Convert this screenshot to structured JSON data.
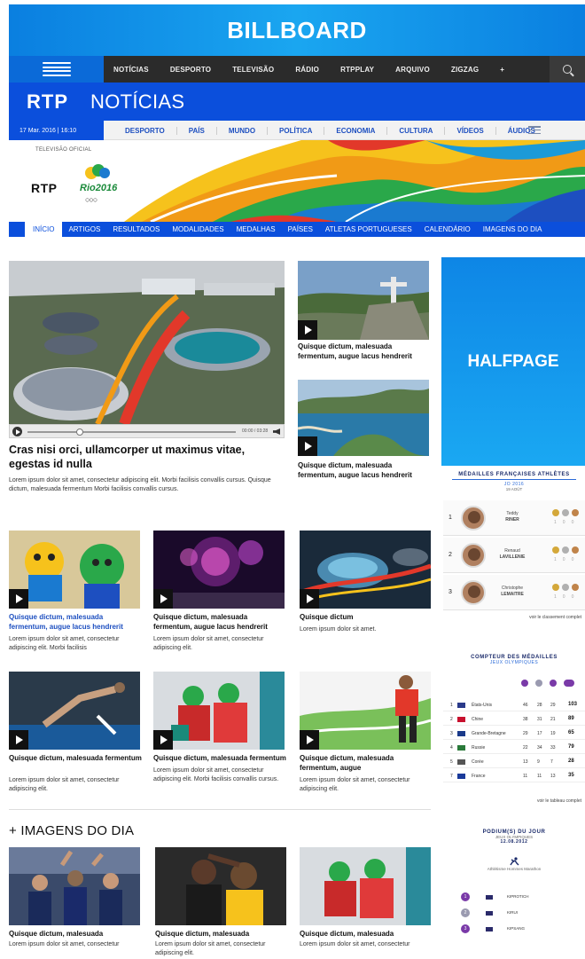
{
  "ads": {
    "billboard": "BILLBOARD",
    "halfpage": "HALFPAGE"
  },
  "topnav": {
    "items": [
      "NOTÍCIAS",
      "DESPORTO",
      "TELEVISÃO",
      "RÁDIO",
      "RTPPLAY",
      "ARQUIVO",
      "ZIGZAG",
      "+"
    ]
  },
  "brand": {
    "rtp": "RTP",
    "noticias": "NOTÍCIAS"
  },
  "subnav": {
    "date": "17 Mar. 2016 | 16:10",
    "items": [
      "DESPORTO",
      "PAÍS",
      "MUNDO",
      "POLÍTICA",
      "ECONOMIA",
      "CULTURA",
      "VÍDEOS",
      "ÁUDIOS"
    ]
  },
  "olympic": {
    "tv_label": "TELEVISÃO OFICIAL",
    "rtp": "RTP",
    "rio": "Rio2016",
    "rings": "○○○",
    "nav": [
      "INÍCIO",
      "ARTIGOS",
      "RESULTADOS",
      "MODALIDADES",
      "MEDALHAS",
      "PAÍSES",
      "ATLETAS PORTUGUESES",
      "CALENDÁRIO",
      "IMAGENS DO DIA"
    ]
  },
  "main": {
    "headline": "Cras nisi orci, ullamcorper ut maximus vitae, egestas id nulla",
    "lead": "Lorem ipsum dolor sit amet, consectetur adipiscing elit. Morbi facilisis convallis cursus. Quisque dictum, malesuada fermentum Morbi facilisis convallis cursus.",
    "player_time": "00:00 / 03:28"
  },
  "side_cards": [
    {
      "title": "Quisque dictum, malesuada fermentum, augue lacus hendrerit"
    },
    {
      "title": "Quisque dictum, malesuada fermentum, augue lacus hendrerit"
    }
  ],
  "grid_row1": [
    {
      "title": "Quisque dictum, malesuada fermentum, augue lacus hendrerit",
      "text": "Lorem ipsum dolor sit amet, consectetur adipiscing elit. Morbi facilisis"
    },
    {
      "title": "Quisque dictum, malesuada fermentum, augue lacus hendrerit",
      "text": "Lorem ipsum dolor sit amet, consectetur adipiscing elit."
    },
    {
      "title": "Quisque dictum",
      "text": "Lorem ipsum dolor sit amet."
    }
  ],
  "grid_row2": [
    {
      "title": "Quisque dictum, malesuada fermentum",
      "text": "Lorem ipsum dolor sit amet, consectetur adipiscing elit."
    },
    {
      "title": "Quisque dictum, malesuada fermentum",
      "text": "Lorem ipsum dolor sit amet, consectetur adipiscing elit. Morbi facilisis convallis cursus."
    },
    {
      "title": "Quisque dictum, malesuada fermentum, augue",
      "text": "Lorem ipsum dolor sit amet, consectetur adipiscing elit."
    }
  ],
  "images_section": {
    "title": "+ IMAGENS DO DIA",
    "items": [
      {
        "title": "Quisque dictum, malesuada",
        "text": "Lorem ipsum dolor sit amet, consectetur"
      },
      {
        "title": "Quisque dictum, malesuada",
        "text": "Lorem ipsum dolor sit amet, consectetur adipiscing elit."
      },
      {
        "title": "Quisque dictum, malesuada",
        "text": "Lorem ipsum dolor sit amet, consectetur"
      }
    ]
  },
  "widget_medals": {
    "title": "MÉDAILLES FRANÇAISES ATHLÈTES",
    "subtitle": "JO 2016",
    "date": "19 AOÛT",
    "rows": [
      {
        "rank": "1",
        "first": "Teddy",
        "last": "RINER",
        "counts": [
          "1",
          "0",
          "0"
        ]
      },
      {
        "rank": "2",
        "first": "Renaud",
        "last": "LAVILLENIE",
        "counts": [
          "1",
          "0",
          "0"
        ]
      },
      {
        "rank": "3",
        "first": "Christophe",
        "last": "LEMAITRE",
        "counts": [
          "1",
          "0",
          "0"
        ]
      }
    ],
    "see_all": "voir le classement complet"
  },
  "widget_table": {
    "title": "COMPTEUR DES MÉDAILLES",
    "subtitle": "JEUX OLYMPIQUES",
    "rows": [
      {
        "rank": "1",
        "country": "États-Unis",
        "g": "46",
        "s": "28",
        "b": "29",
        "t": "103",
        "flag": "#2a3a8a"
      },
      {
        "rank": "2",
        "country": "Chine",
        "g": "38",
        "s": "31",
        "b": "21",
        "t": "89",
        "flag": "#c8102e"
      },
      {
        "rank": "3",
        "country": "Grande-Bretagne",
        "g": "29",
        "s": "17",
        "b": "19",
        "t": "65",
        "flag": "#1a3a8a"
      },
      {
        "rank": "4",
        "country": "Russie",
        "g": "22",
        "s": "34",
        "b": "33",
        "t": "79",
        "flag": "#2a7a3a"
      },
      {
        "rank": "5",
        "country": "Corée",
        "g": "13",
        "s": "9",
        "b": "7",
        "t": "28",
        "flag": "#555555"
      },
      {
        "rank": "7",
        "country": "France",
        "g": "11",
        "s": "11",
        "b": "13",
        "t": "35",
        "flag": "#1a3a9a"
      }
    ],
    "see_all": "voir le tableau complet"
  },
  "widget_podium": {
    "title": "PODIUM(S) DU JOUR",
    "subtitle": "JEUX OLYMPIQUES",
    "date": "12.08.2012",
    "event": "Athlétisme Hommes Marathon",
    "rows": [
      {
        "pos": "1",
        "name": "KIPROTICH"
      },
      {
        "pos": "2",
        "name": "KIRUI"
      },
      {
        "pos": "3",
        "name": "KIPSANG"
      }
    ]
  },
  "colors": {
    "brand_blue": "#0b4fdc",
    "ad_blue": "#1aa6f0",
    "link_blue": "#1d4fc0",
    "gold": "#d4a83a",
    "silver": "#b0b0b0",
    "bronze": "#c0844a"
  }
}
